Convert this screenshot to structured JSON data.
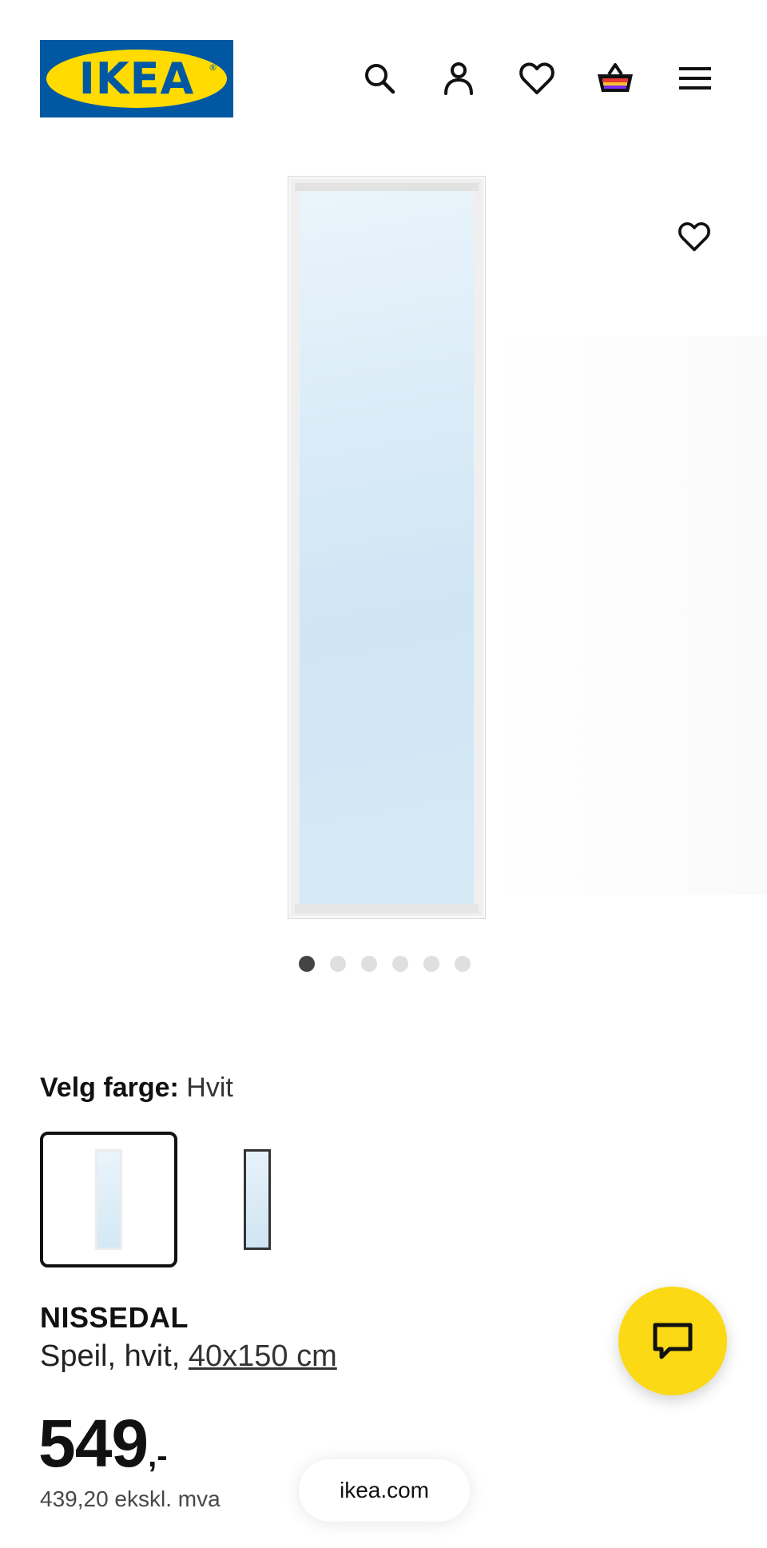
{
  "header": {
    "logo_text": "IKEA",
    "logo_registered": "®",
    "icons": [
      "search-icon",
      "account-icon",
      "heart-icon",
      "basket-icon",
      "hamburger-menu-icon"
    ]
  },
  "gallery": {
    "image_count": 6,
    "active_index": 0
  },
  "color_select": {
    "label": "Velg farge:",
    "value": "Hvit"
  },
  "product": {
    "name": "NISSEDAL",
    "desc_prefix": "Speil, hvit, ",
    "size": "40x150 cm",
    "price_main": "549",
    "price_suffix": ",-",
    "price_ex_vat": "439,20 ekskl. mva"
  },
  "browser": {
    "domain": "ikea.com"
  },
  "colors": {
    "brand_blue": "#0058a3",
    "brand_yellow": "#ffdb00",
    "chat_yellow": "#fbd914"
  }
}
